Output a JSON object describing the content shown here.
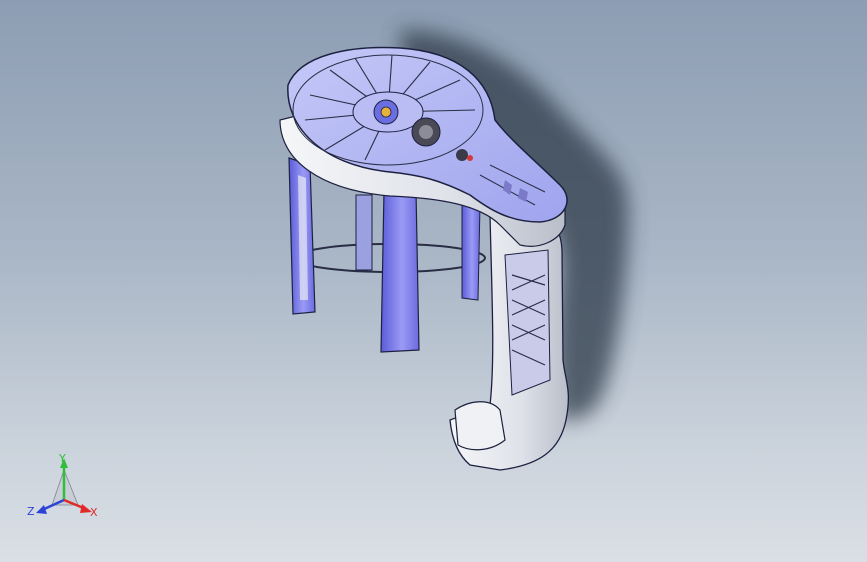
{
  "viewport": {
    "background_top": "#8d9db3",
    "background_bottom": "#dadfe5"
  },
  "model": {
    "body_color": "#8f8ff0",
    "edge_color": "#1d2140",
    "shell_color": "#e6e8ee",
    "shadow_color": "#2f3a4a"
  },
  "triad": {
    "y_label": "Y",
    "z_label": "Z",
    "x_label": "X",
    "y_color": "#2fbf3a",
    "z_color": "#2c44d6",
    "x_color": "#e02a2a"
  }
}
